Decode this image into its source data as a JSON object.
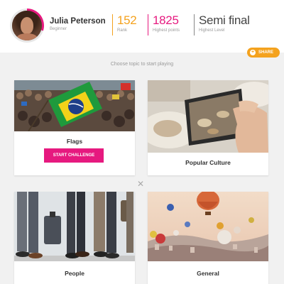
{
  "profile": {
    "name": "Julia Peterson",
    "level": "Beginner",
    "avatar_icon": "user-avatar-photo"
  },
  "stats": {
    "rank": {
      "value": "152",
      "label": "Rank",
      "color": "#f4a21e"
    },
    "points": {
      "value": "1825",
      "label": "Highest points",
      "color": "#e6197f"
    },
    "level": {
      "value": "Semi final",
      "label": "Highest Level",
      "color": "#888888"
    }
  },
  "share": {
    "label": "SHARE",
    "icon": "plus-icon",
    "color": "#f4a21e"
  },
  "prompt": "Choose topic to start playing",
  "topics": [
    {
      "title": "Flags",
      "button": "START CHALLENGE"
    },
    {
      "title": "Popular Culture"
    },
    {
      "title": "People"
    },
    {
      "title": "General"
    }
  ],
  "colors": {
    "accent": "#e6197f",
    "secondary": "#f4a21e",
    "background": "#f1f1f1"
  }
}
